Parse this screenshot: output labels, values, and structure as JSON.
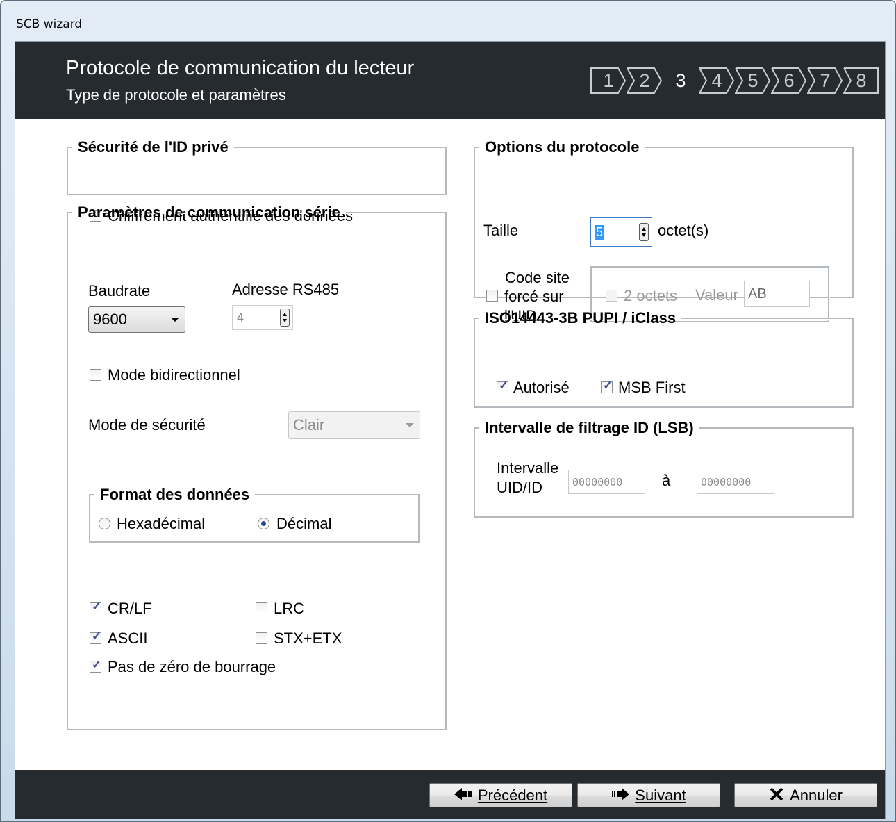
{
  "window": {
    "title": "SCB wizard"
  },
  "header": {
    "title": "Protocole de communication du lecteur",
    "subtitle": "Type de protocole et paramètres",
    "steps": [
      "1",
      "2",
      "3",
      "4",
      "5",
      "6",
      "7",
      "8"
    ],
    "current_step": "3"
  },
  "security": {
    "legend": "Sécurité de l'ID privé",
    "auth_encryption": {
      "label": "Chiffrement authentifié des données",
      "checked": false
    }
  },
  "serial": {
    "legend": "Paramètres de communication série",
    "baudrate_label": "Baudrate",
    "baudrate_value": "9600",
    "rs485_label": "Adresse RS485",
    "rs485_value": "4",
    "bidirectional": {
      "label": "Mode bidirectionnel",
      "checked": false
    },
    "security_mode_label": "Mode de sécurité",
    "security_mode_value": "Clair",
    "data_format": {
      "legend": "Format des données",
      "hex_label": "Hexadécimal",
      "dec_label": "Décimal",
      "selected": "Décimal"
    },
    "crlf": {
      "label": "CR/LF",
      "checked": true
    },
    "lrc": {
      "label": "LRC",
      "checked": false
    },
    "ascii": {
      "label": "ASCII",
      "checked": true
    },
    "stxetx": {
      "label": "STX+ETX",
      "checked": false
    },
    "no_padding": {
      "label": "Pas de zéro de bourrage",
      "checked": true
    }
  },
  "protocol_options": {
    "legend": "Options du protocole",
    "size_label": "Taille",
    "size_value": "5",
    "size_unit": "octet(s)",
    "site_code_line1": "Code site",
    "site_code_line2": "forcé sur",
    "site_code_line3": "l'UID",
    "site_code_checked": false,
    "two_bytes": {
      "label": "2 octets",
      "checked": false
    },
    "value_label": "Valeur",
    "value": "AB"
  },
  "iso": {
    "legend": "ISO14443-3B PUPI / iClass",
    "authorized": {
      "label": "Autorisé",
      "checked": true
    },
    "msb_first": {
      "label": "MSB First",
      "checked": true
    }
  },
  "filter": {
    "legend": "Intervalle de filtrage ID (LSB)",
    "range_label_1": "Intervalle",
    "range_label_2": "UID/ID",
    "from_placeholder": "00000000",
    "to_label": "à",
    "to_placeholder": "00000000"
  },
  "footer": {
    "prev_label": "Précédent",
    "next_label": "Suivant",
    "cancel_label": "Annuler"
  }
}
